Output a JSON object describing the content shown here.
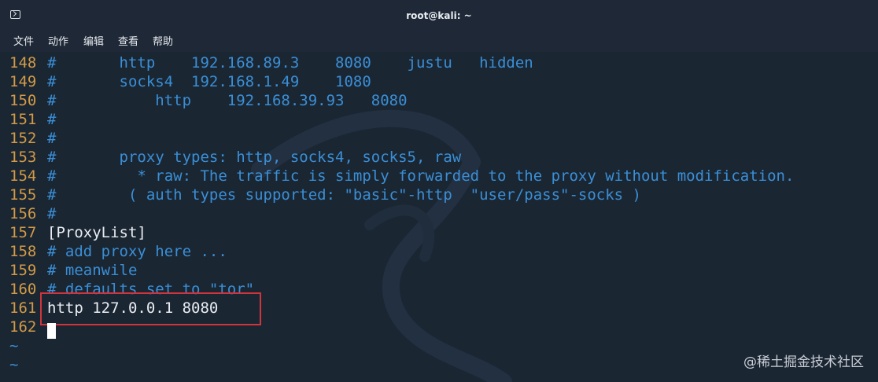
{
  "window": {
    "title": "root@kali: ~"
  },
  "menu": [
    "文件",
    "动作",
    "编辑",
    "查看",
    "帮助"
  ],
  "lines": [
    {
      "num": "148",
      "text": "#       http    192.168.89.3    8080    justu   hidden",
      "style": "cmt"
    },
    {
      "num": "149",
      "text": "#       socks4  192.168.1.49    1080",
      "style": "cmt"
    },
    {
      "num": "150",
      "text": "#           http    192.168.39.93   8080",
      "style": "cmt"
    },
    {
      "num": "151",
      "text": "#",
      "style": "cmt"
    },
    {
      "num": "152",
      "text": "#",
      "style": "cmt"
    },
    {
      "num": "153",
      "text": "#       proxy types: http, socks4, socks5, raw",
      "style": "cmt"
    },
    {
      "num": "154",
      "text": "#         * raw: The traffic is simply forwarded to the proxy without modification.",
      "style": "cmt"
    },
    {
      "num": "155",
      "text": "#        ( auth types supported: \"basic\"-http  \"user/pass\"-socks )",
      "style": "cmt"
    },
    {
      "num": "156",
      "text": "#",
      "style": "cmt"
    },
    {
      "num": "157",
      "text": "[ProxyList]",
      "style": "plain"
    },
    {
      "num": "158",
      "text": "# add proxy here ...",
      "style": "cmt"
    },
    {
      "num": "159",
      "text": "# meanwile",
      "style": "cmt"
    },
    {
      "num": "160",
      "text": "# defaults set to \"tor\"",
      "style": "cmt"
    },
    {
      "num": "161",
      "text": "http 127.0.0.1 8080",
      "style": "plain"
    },
    {
      "num": "162",
      "text": "",
      "style": "plain"
    }
  ],
  "tildes": [
    "~",
    "~"
  ],
  "watermark": "@稀土掘金技术社区",
  "colors": {
    "background": "#1b2633",
    "line_number": "#d19a47",
    "comment": "#3a8fd6",
    "text": "#e9edf2",
    "highlight_box": "#d1343c"
  }
}
